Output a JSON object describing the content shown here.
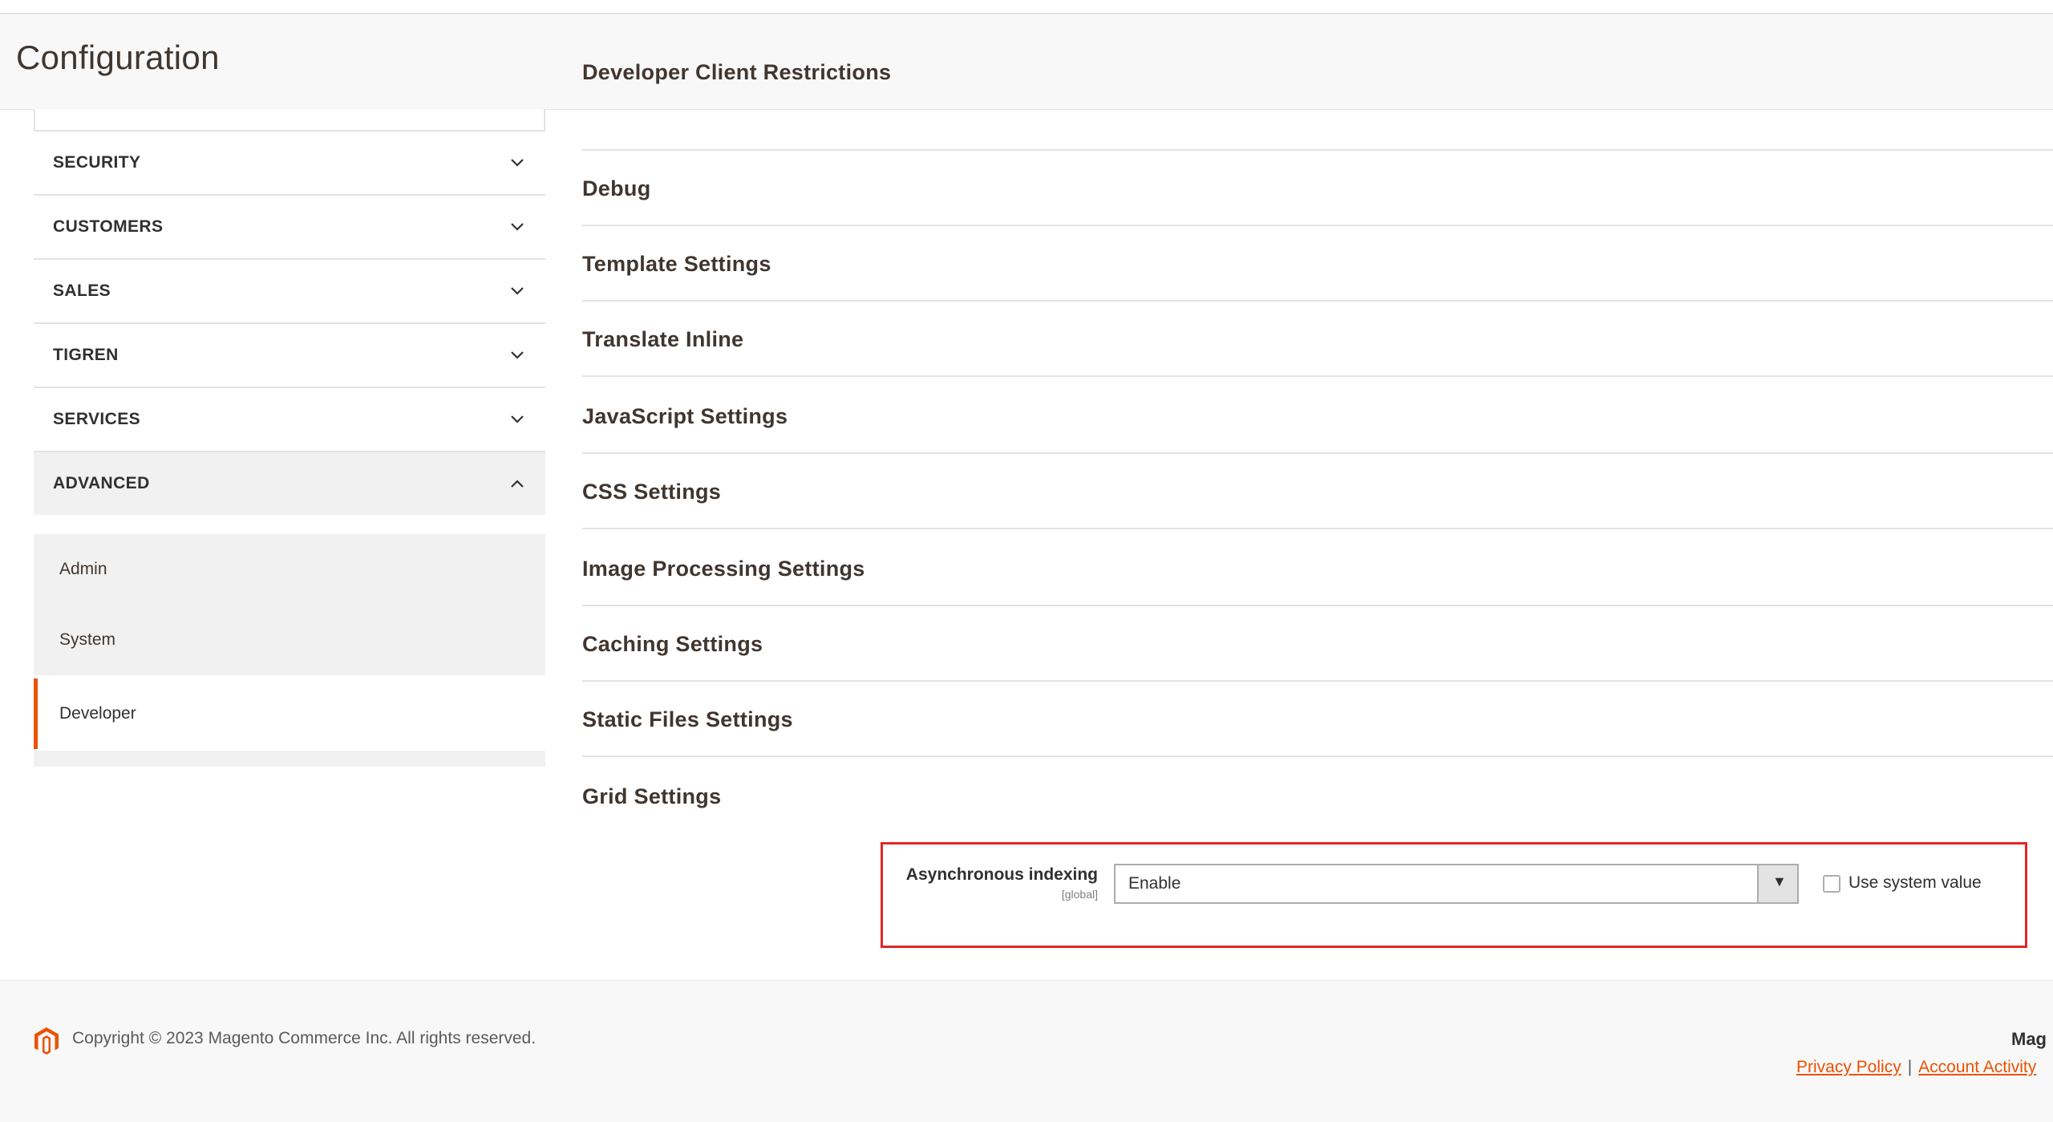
{
  "page": {
    "title": "Configuration"
  },
  "sidebar": {
    "items": [
      {
        "label": "SECURITY"
      },
      {
        "label": "CUSTOMERS"
      },
      {
        "label": "SALES"
      },
      {
        "label": "TIGREN"
      },
      {
        "label": "SERVICES"
      },
      {
        "label": "ADVANCED",
        "expanded": true
      }
    ],
    "advanced_subitems": [
      {
        "label": "Admin"
      },
      {
        "label": "System"
      },
      {
        "label": "Developer",
        "active": true
      }
    ]
  },
  "sections": [
    {
      "title": "Developer Client Restrictions"
    },
    {
      "title": "Debug"
    },
    {
      "title": "Template Settings"
    },
    {
      "title": "Translate Inline"
    },
    {
      "title": "JavaScript Settings"
    },
    {
      "title": "CSS Settings"
    },
    {
      "title": "Image Processing Settings"
    },
    {
      "title": "Caching Settings"
    },
    {
      "title": "Static Files Settings"
    },
    {
      "title": "Grid Settings"
    }
  ],
  "grid_field": {
    "label": "Asynchronous indexing",
    "scope": "[global]",
    "value": "Enable",
    "use_system_value_label": "Use system value",
    "use_system_value_checked": false,
    "highlight_color": "#e22626"
  },
  "footer": {
    "copyright": "Copyright © 2023 Magento Commerce Inc. All rights reserved.",
    "brand": "Mag",
    "privacy_link": "Privacy Policy",
    "separator": "|",
    "account_activity_link": "Account Activity",
    "link_color": "#eb5202"
  },
  "icons": {
    "collapsed": "chevron-down-icon",
    "expanded": "chevron-up-icon",
    "select_arrow": "caret-down-icon",
    "logo": "magento-logo-icon"
  }
}
